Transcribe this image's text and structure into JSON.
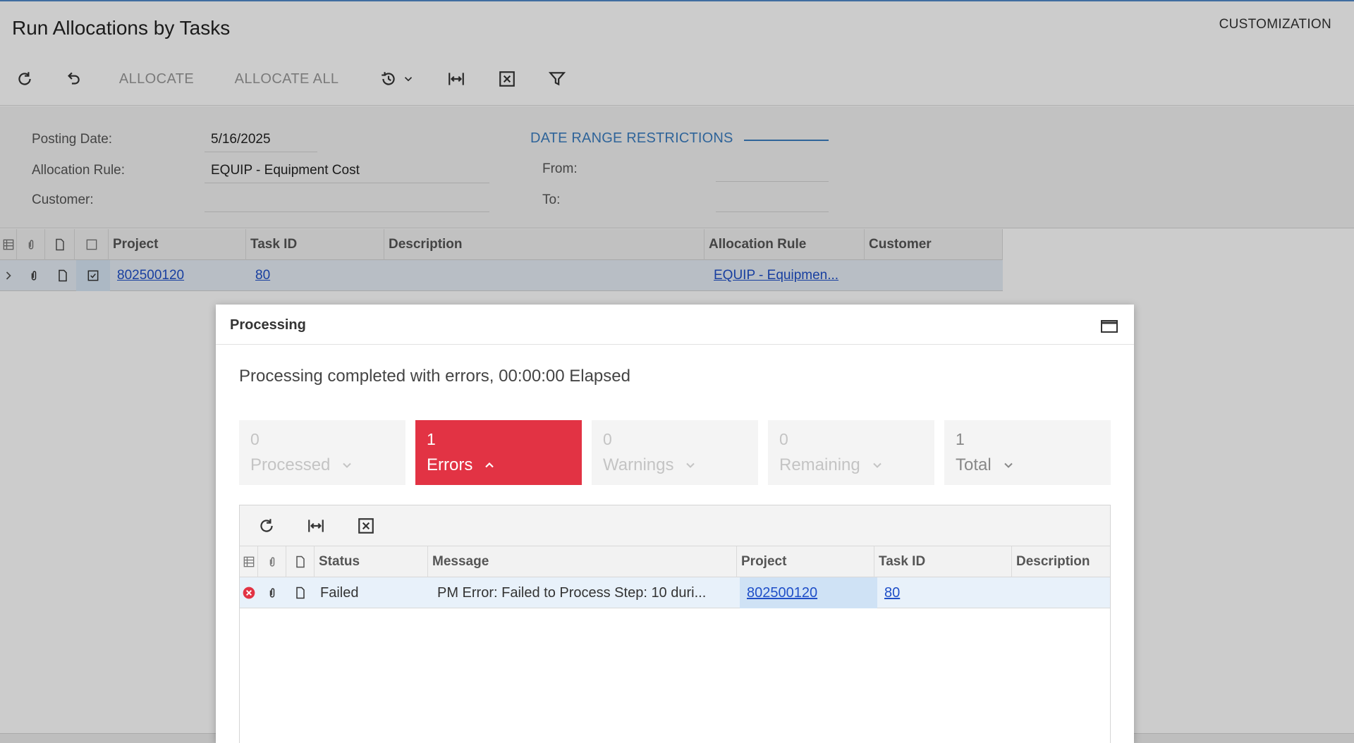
{
  "page": {
    "title": "Run Allocations by Tasks",
    "customization": "CUSTOMIZATION"
  },
  "toolbar": {
    "allocate_label": "ALLOCATE",
    "allocate_all_label": "ALLOCATE ALL"
  },
  "form": {
    "posting_date_label": "Posting Date:",
    "posting_date_value": "5/16/2025",
    "allocation_rule_label": "Allocation Rule:",
    "allocation_rule_value": "EQUIP - Equipment Cost",
    "customer_label": "Customer:",
    "customer_value": "",
    "date_range_title": "DATE RANGE RESTRICTIONS",
    "from_label": "From:",
    "from_value": "",
    "to_label": "To:",
    "to_value": ""
  },
  "grid": {
    "columns": [
      "Project",
      "Task ID",
      "Description",
      "Allocation Rule",
      "Customer"
    ],
    "rows": [
      {
        "project": "802500120",
        "task_id": "80",
        "description": "",
        "allocation_rule": "EQUIP - Equipmen...",
        "customer": "",
        "selected": true
      }
    ]
  },
  "dialog": {
    "title": "Processing",
    "status": "Processing completed with errors, 00:00:00 Elapsed",
    "tiles": [
      {
        "count": "0",
        "label": "Processed"
      },
      {
        "count": "1",
        "label": "Errors"
      },
      {
        "count": "0",
        "label": "Warnings"
      },
      {
        "count": "0",
        "label": "Remaining"
      },
      {
        "count": "1",
        "label": "Total"
      }
    ],
    "columns": [
      "Status",
      "Message",
      "Project",
      "Task ID",
      "Description"
    ],
    "rows": [
      {
        "status": "Failed",
        "message": "PM Error: Failed to Process Step: 10 duri...",
        "project": "802500120",
        "task_id": "80",
        "description": ""
      }
    ]
  },
  "colors": {
    "accent": "#3b7dc0",
    "error": "#e23344",
    "link": "#1f4fc8"
  },
  "icons": [
    "refresh-icon",
    "undo-icon",
    "schedule-icon",
    "chevron-down-icon",
    "fit-columns-icon",
    "export-excel-icon",
    "filter-icon",
    "maximize-icon",
    "error-status-icon",
    "attachment-icon",
    "note-icon",
    "checkbox-icon",
    "expand-row-icon"
  ]
}
